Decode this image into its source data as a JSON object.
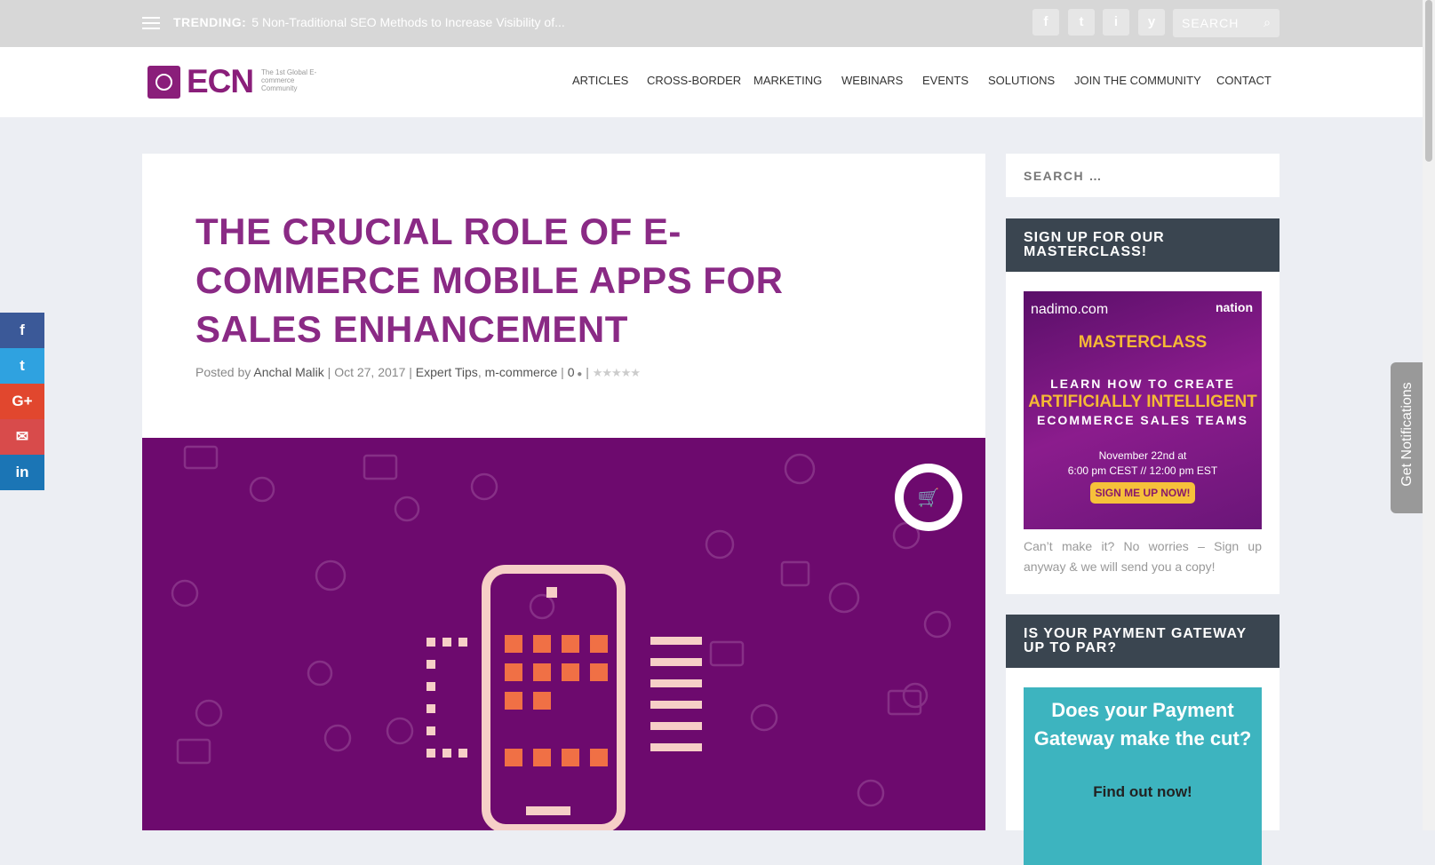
{
  "topbar": {
    "trending_label": "TRENDING:",
    "trending_text": "5 Non-Traditional SEO Methods to Increase Visibility of...",
    "social": [
      "f",
      "t",
      "i",
      "y"
    ],
    "search_placeholder": "SEARCH"
  },
  "logo": {
    "name": "ECN",
    "tagline": "The 1st Global E-commerce Community"
  },
  "nav": [
    "ARTICLES",
    "CROSS-BORDER",
    "MARKETING",
    "WEBINARS",
    "EVENTS",
    "SOLUTIONS",
    "JOIN THE COMMUNITY",
    "CONTACT"
  ],
  "article": {
    "title": "THE CRUCIAL ROLE OF E-COMMERCE MOBILE APPS FOR SALES ENHANCEMENT",
    "posted_by": "Posted by",
    "author": "Anchal Malik",
    "date": "Oct 27, 2017",
    "cat1": "Expert Tips",
    "cat2": "m-commerce",
    "comments": "0",
    "rating_stars": "★★★★★"
  },
  "share": [
    "f",
    "t",
    "G+",
    "✉",
    "in"
  ],
  "sidebar": {
    "search_placeholder": "SEARCH …",
    "widget1_title": "SIGN UP FOR OUR MASTERCLASS!",
    "promo1": {
      "brand": "nadimo.com",
      "brand2": "nation",
      "masterclass": "MASTERCLASS",
      "line1": "LEARN HOW TO CREATE",
      "line2": "ARTIFICIALLY INTELLIGENT",
      "line3": "ECOMMERCE SALES TEAMS",
      "date1": "November 22nd at",
      "date2": "6:00 pm CEST // 12:00 pm EST",
      "button": "SIGN ME UP NOW!"
    },
    "note": "Can’t make it? No worries – Sign up anyway & we will send you a copy!",
    "widget2_title": "IS YOUR PAYMENT GATEWAY UP TO PAR?",
    "promo2": {
      "title": "Does your Payment Gateway make the cut?",
      "cta": "Find out now!"
    }
  },
  "notifications": "Get Notifications"
}
